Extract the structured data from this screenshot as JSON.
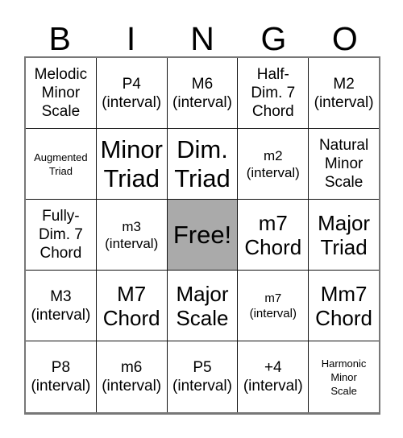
{
  "card": {
    "title_letters": [
      "B",
      "I",
      "N",
      "G",
      "O"
    ],
    "free_space_color": "#aaaaaa",
    "grid_line_color": "#111111",
    "grid_border_color": "#777777",
    "background_color": "#ffffff",
    "text_color": "#000000",
    "rows": [
      [
        {
          "text": "Melodic\nMinor\nScale",
          "size": "md",
          "free": false
        },
        {
          "text": "P4\n(interval)",
          "size": "md",
          "free": false
        },
        {
          "text": "M6\n(interval)",
          "size": "md",
          "free": false
        },
        {
          "text": "Half-\nDim. 7\nChord",
          "size": "md",
          "free": false
        },
        {
          "text": "M2\n(interval)",
          "size": "md",
          "free": false
        }
      ],
      [
        {
          "text": "Augmented\nTriad",
          "size": "xxs",
          "free": false
        },
        {
          "text": "Minor\nTriad",
          "size": "xl",
          "free": false
        },
        {
          "text": "Dim.\nTriad",
          "size": "xl",
          "free": false
        },
        {
          "text": "m2\n(interval)",
          "size": "sm",
          "free": false
        },
        {
          "text": "Natural\nMinor\nScale",
          "size": "md",
          "free": false
        }
      ],
      [
        {
          "text": "Fully-\nDim. 7\nChord",
          "size": "md",
          "free": false
        },
        {
          "text": "m3\n(interval)",
          "size": "sm",
          "free": false
        },
        {
          "text": "Free!",
          "size": "xl",
          "free": true
        },
        {
          "text": "m7\nChord",
          "size": "lg",
          "free": false
        },
        {
          "text": "Major\nTriad",
          "size": "lg",
          "free": false
        }
      ],
      [
        {
          "text": "M3\n(interval)",
          "size": "md",
          "free": false
        },
        {
          "text": "M7\nChord",
          "size": "lg",
          "free": false
        },
        {
          "text": "Major\nScale",
          "size": "lg",
          "free": false
        },
        {
          "text": "m7\n(interval)",
          "size": "xs",
          "free": false
        },
        {
          "text": "Mm7\nChord",
          "size": "lg",
          "free": false
        }
      ],
      [
        {
          "text": "P8\n(interval)",
          "size": "md",
          "free": false
        },
        {
          "text": "m6\n(interval)",
          "size": "md",
          "free": false
        },
        {
          "text": "P5\n(interval)",
          "size": "md",
          "free": false
        },
        {
          "text": "+4\n(interval)",
          "size": "md",
          "free": false
        },
        {
          "text": "Harmonic\nMinor\nScale",
          "size": "xxs",
          "free": false
        }
      ]
    ]
  }
}
